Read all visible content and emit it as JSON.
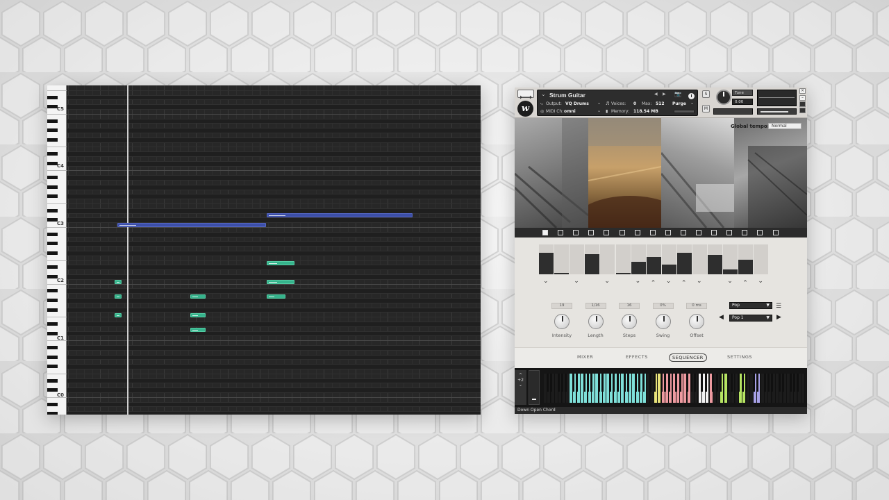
{
  "piano_roll": {
    "octave_labels": [
      "C5",
      "C4",
      "C3",
      "C2",
      "C1",
      "C0"
    ]
  },
  "plugin": {
    "instrument_name": "Strum Guitar",
    "output_label": "Output:",
    "output_value": "VQ Drums",
    "voices_label": "Voices:",
    "voices_value": "0",
    "max_label": "Max:",
    "max_value": "512",
    "purge_label": "Purge",
    "midi_label": "MIDI Ch:",
    "midi_value": "omni",
    "memory_label": "Memory:",
    "memory_value": "118.54 MB",
    "tune_label": "Tune",
    "tune_value": "0.00",
    "logo_letter": "w",
    "solo_label": "S",
    "mute_label": "M",
    "global_tempo_label": "Global tempo:",
    "global_tempo_value": "Normal",
    "step_strip": [
      1,
      0,
      0,
      0,
      0,
      0,
      0,
      0,
      0,
      0,
      0,
      0,
      0,
      0,
      0,
      0
    ],
    "sequencer": {
      "bars": [
        0.72,
        0.04,
        0,
        0.68,
        0,
        0.04,
        0.42,
        0.58,
        0.32,
        0.72,
        0,
        0.66,
        0.16,
        0.48,
        0
      ],
      "chevrons": [
        "down",
        "",
        "down",
        "",
        "down",
        "",
        "down",
        "up",
        "down",
        "up",
        "down",
        "",
        "down",
        "up",
        "down"
      ],
      "knobs": [
        {
          "label": "Intensity",
          "value": "19"
        },
        {
          "label": "Length",
          "value": "1/16"
        },
        {
          "label": "Steps",
          "value": "16"
        },
        {
          "label": "Swing",
          "value": "0%"
        },
        {
          "label": "Offset",
          "value": "0 ms"
        }
      ],
      "style_dropdown": "Pop",
      "pattern_dropdown": "Pop 1"
    },
    "tabs": [
      "MIXER",
      "EFFECTS",
      "SEQUENCER",
      "SETTINGS"
    ],
    "active_tab": "SEQUENCER",
    "octave_shift": "+2",
    "status_text": "Down Open Chord",
    "colors": {
      "cyan_keys": "#7fe0d9",
      "yellow_keys": "#e9e37a",
      "pink_keys": "#ee9aa0",
      "white_keys": "#f2f2f2",
      "lime_keys": "#b6e463",
      "violet_keys": "#a8a2e8"
    }
  }
}
